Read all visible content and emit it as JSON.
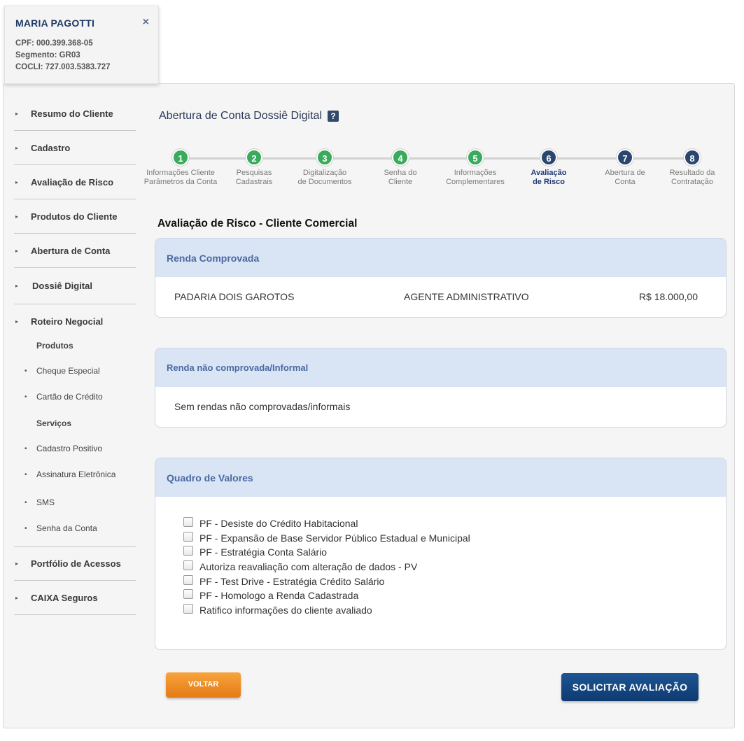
{
  "client": {
    "name": "MARIA PAGOTTI",
    "close": "×",
    "cpf": "CPF: 000.399.368-05",
    "segment": "Segmento: GR03",
    "cocli": "COCLI: 727.003.5383.727"
  },
  "sidebar": {
    "items": [
      {
        "label": "Resumo do Cliente"
      },
      {
        "label": "Cadastro"
      },
      {
        "label": "Avaliação de Risco"
      },
      {
        "label": "Produtos do Cliente"
      },
      {
        "label": "Abertura de Conta"
      },
      {
        "label": "Dossiê Digital"
      },
      {
        "label": "Roteiro Negocial"
      }
    ],
    "sub_heading_products": "Produtos",
    "products": [
      {
        "label": "Cheque Especial"
      },
      {
        "label": "Cartão de Crédito"
      }
    ],
    "sub_heading_services": "Serviços",
    "services": [
      {
        "label": "Cadastro Positivo"
      },
      {
        "label": "Assinatura Eletrônica"
      },
      {
        "label": "SMS"
      },
      {
        "label": "Senha da Conta"
      }
    ],
    "bottom_items": [
      {
        "label": "Portfólio de Acessos"
      },
      {
        "label": "CAIXA Seguros"
      }
    ]
  },
  "page": {
    "title": "Abertura de Conta Dossiê Digital",
    "help": "?"
  },
  "stepper": {
    "steps": [
      {
        "number": "1",
        "label_line1": "Informações Cliente",
        "label_line2": "Parâmetros da Conta",
        "state": "done"
      },
      {
        "number": "2",
        "label_line1": "Pesquisas",
        "label_line2": "Cadastrais",
        "state": "done"
      },
      {
        "number": "3",
        "label_line1": "Digitalização",
        "label_line2": "de Documentos",
        "state": "done"
      },
      {
        "number": "4",
        "label_line1": "Senha do",
        "label_line2": "Cliente",
        "state": "done"
      },
      {
        "number": "5",
        "label_line1": "Informações",
        "label_line2": "Complementares",
        "state": "done"
      },
      {
        "number": "6",
        "label_line1": "Avaliação",
        "label_line2": "de Risco",
        "state": "active"
      },
      {
        "number": "7",
        "label_line1": "Abertura de",
        "label_line2": "Conta",
        "state": "pending"
      },
      {
        "number": "8",
        "label_line1": "Resultado da",
        "label_line2": "Contratação",
        "state": "pending"
      }
    ],
    "colors": {
      "done": "#3aaa5c",
      "active": "#2a466e",
      "pending": "#2a466e",
      "line": "#d2d2d2"
    }
  },
  "section": {
    "title": "Avaliação de Risco - Cliente Comercial"
  },
  "renda_comprovada": {
    "heading": "Renda Comprovada",
    "company": "PADARIA DOIS GAROTOS",
    "occupation": "AGENTE ADMINISTRATIVO",
    "amount": "R$ 18.000,00"
  },
  "renda_informal": {
    "heading": "Renda não comprovada/Informal",
    "empty_text": "Sem rendas não comprovadas/informais"
  },
  "quadro_valores": {
    "heading": "Quadro de Valores",
    "options": [
      {
        "label": "PF - Desiste do Crédito Habitacional"
      },
      {
        "label": "PF - Expansão de Base Servidor Público Estadual e Municipal"
      },
      {
        "label": "PF - Estratégia Conta Salário"
      },
      {
        "label": "Autoriza reavaliação com alteração de dados - PV"
      },
      {
        "label": "PF - Test Drive - Estratégia Crédito Salário"
      },
      {
        "label": "PF - Homologo a Renda Cadastrada"
      },
      {
        "label": "Ratifico informações do cliente avaliado"
      }
    ]
  },
  "buttons": {
    "back": "VOLTAR",
    "submit": "SOLICITAR AVALIAÇÃO"
  }
}
